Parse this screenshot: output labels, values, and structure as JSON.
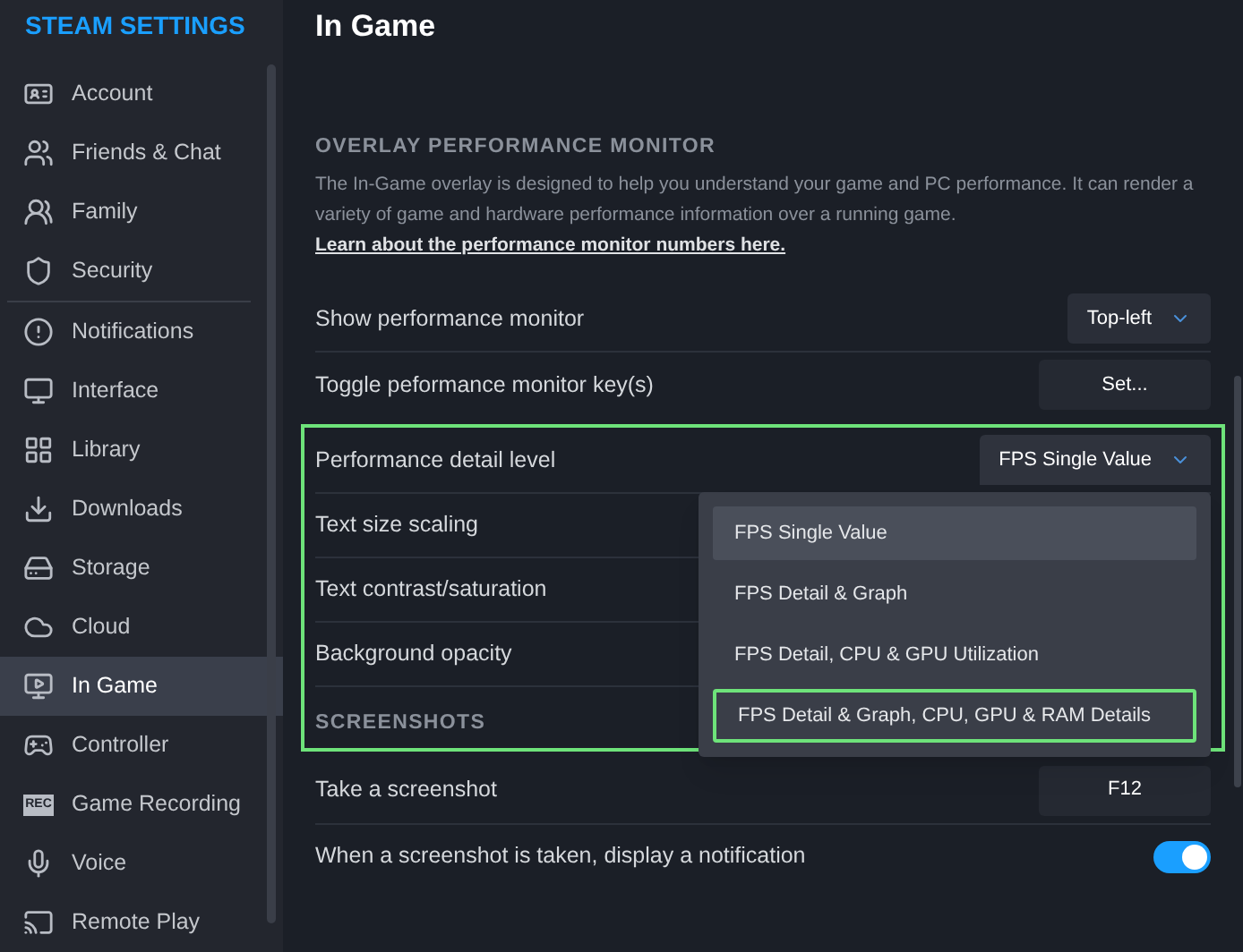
{
  "sidebar": {
    "title": "STEAM SETTINGS",
    "items": [
      {
        "label": "Account",
        "selected": false
      },
      {
        "label": "Friends & Chat",
        "selected": false
      },
      {
        "label": "Family",
        "selected": false
      },
      {
        "label": "Security",
        "selected": false
      },
      {
        "label": "Notifications",
        "selected": false
      },
      {
        "label": "Interface",
        "selected": false
      },
      {
        "label": "Library",
        "selected": false
      },
      {
        "label": "Downloads",
        "selected": false
      },
      {
        "label": "Storage",
        "selected": false
      },
      {
        "label": "Cloud",
        "selected": false
      },
      {
        "label": "In Game",
        "selected": true
      },
      {
        "label": "Controller",
        "selected": false
      },
      {
        "label": "Game Recording",
        "selected": false,
        "icon_text": "REC"
      },
      {
        "label": "Voice",
        "selected": false
      },
      {
        "label": "Remote Play",
        "selected": false
      }
    ]
  },
  "page": {
    "title": "In Game",
    "groups": [
      {
        "highlighted": false,
        "blocks": [
          {
            "kind": "header",
            "text": "OVERLAY PERFORMANCE MONITOR"
          },
          {
            "kind": "paragraph",
            "text": "The In-Game overlay is designed to help you understand your game and PC performance. It can render a variety of game and hardware performance information over a running game.",
            "link": "Learn about the performance monitor numbers here."
          },
          {
            "kind": "dropdown",
            "label": "Show performance monitor",
            "value": "Top-left"
          },
          {
            "kind": "button",
            "label": "Toggle peformance monitor key(s)",
            "value": "Set..."
          }
        ]
      },
      {
        "highlighted": true,
        "blocks": [
          {
            "kind": "dropdown",
            "label": "Performance detail level",
            "value": "FPS Single Value",
            "expanded": true,
            "options": [
              {
                "label": "FPS Single Value",
                "selected": true,
                "highlighted": false
              },
              {
                "label": "FPS Detail & Graph",
                "selected": false,
                "highlighted": false
              },
              {
                "label": "FPS Detail, CPU & GPU Utilization",
                "selected": false,
                "highlighted": false
              },
              {
                "label": "FPS Detail & Graph, CPU, GPU & RAM Details",
                "selected": false,
                "highlighted": true
              }
            ]
          },
          {
            "kind": "label",
            "label": "Text size scaling"
          },
          {
            "kind": "label",
            "label": "Text contrast/saturation"
          },
          {
            "kind": "label",
            "label": "Background opacity"
          },
          {
            "kind": "header",
            "text": "SCREENSHOTS"
          }
        ]
      },
      {
        "highlighted": false,
        "blocks": [
          {
            "kind": "button",
            "label": "Take a screenshot",
            "value": "F12"
          },
          {
            "kind": "toggle",
            "label": "When a screenshot is taken, display a notification",
            "on": true
          }
        ]
      }
    ]
  }
}
